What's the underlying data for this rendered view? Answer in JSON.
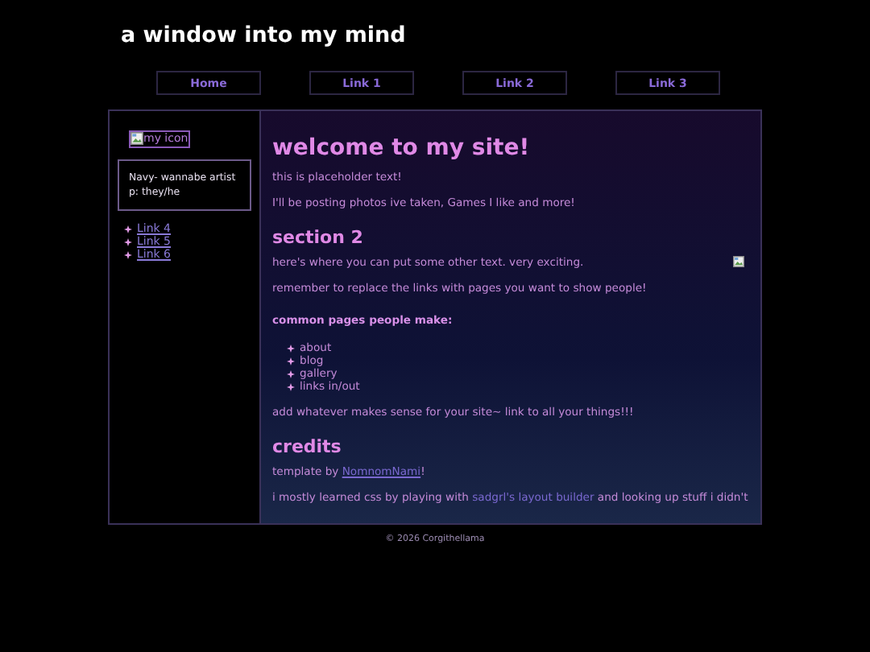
{
  "site_title": "a window into my mind",
  "nav": [
    {
      "label": "Home"
    },
    {
      "label": "Link 1"
    },
    {
      "label": "Link 2"
    },
    {
      "label": "Link 3"
    }
  ],
  "sidebar": {
    "icon_alt": "my icon",
    "bio": [
      "Navy- wannabe artist",
      "p: they/he"
    ],
    "links": [
      {
        "label": "Link 4"
      },
      {
        "label": "Link 5"
      },
      {
        "label": "Link 6"
      }
    ]
  },
  "content": [
    {
      "kind": "heading",
      "text": "welcome to my site!"
    },
    {
      "kind": "para",
      "parts": [
        {
          "text": "this is placeholder text!"
        }
      ]
    },
    {
      "kind": "para",
      "parts": [
        {
          "text": "I'll be posting photos ive taken, Games I like and more!"
        }
      ]
    },
    {
      "kind": "subheading",
      "text": "section 2"
    },
    {
      "kind": "para",
      "image": true,
      "parts": [
        {
          "text": "here's where you can put some other text. very exciting."
        }
      ]
    },
    {
      "kind": "para",
      "parts": [
        {
          "text": "remember to replace the links with pages you want to show people!"
        }
      ]
    },
    {
      "kind": "label",
      "text": "common pages people make:"
    },
    {
      "kind": "list",
      "items": [
        "about",
        "blog",
        "gallery",
        "links in/out"
      ]
    },
    {
      "kind": "para",
      "parts": [
        {
          "text": "add whatever makes sense for your site~ link to all your things!!!"
        }
      ]
    },
    {
      "kind": "subheading",
      "text": "credits"
    },
    {
      "kind": "para",
      "parts": [
        {
          "text": "template by "
        },
        {
          "text": "NomnomNami",
          "kind": "link",
          "underlined": true
        },
        {
          "text": "!"
        }
      ]
    },
    {
      "kind": "para",
      "parts": [
        {
          "text": "i mostly learned css by playing with "
        },
        {
          "text": "sadgrl's layout builder",
          "kind": "link",
          "underlined": false
        },
        {
          "text": " and looking up stuff i didn't"
        }
      ]
    }
  ],
  "footer": "© 2026 Corgithellama"
}
